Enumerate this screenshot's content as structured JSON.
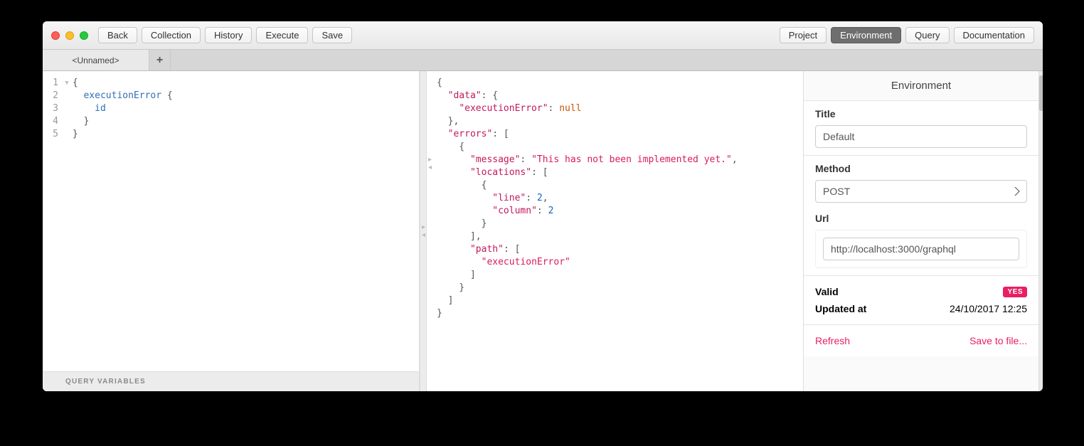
{
  "toolbar": {
    "left": [
      "Back",
      "Collection",
      "History",
      "Execute",
      "Save"
    ],
    "right": [
      "Project",
      "Environment",
      "Query",
      "Documentation"
    ],
    "active_right_index": 1
  },
  "tabs": {
    "items": [
      "<Unnamed>"
    ],
    "add_icon": "+"
  },
  "editor": {
    "lines": [
      {
        "n": "1",
        "fold": "▾",
        "tokens": [
          {
            "t": "{",
            "c": "punc"
          }
        ]
      },
      {
        "n": "2",
        "fold": "",
        "tokens": [
          {
            "t": "  ",
            "c": "punc"
          },
          {
            "t": "executionError",
            "c": "field dec"
          },
          {
            "t": " {",
            "c": "punc"
          }
        ]
      },
      {
        "n": "3",
        "fold": "",
        "tokens": [
          {
            "t": "    ",
            "c": "punc"
          },
          {
            "t": "id",
            "c": "field"
          }
        ]
      },
      {
        "n": "4",
        "fold": "",
        "tokens": [
          {
            "t": "  }",
            "c": "punc"
          }
        ]
      },
      {
        "n": "5",
        "fold": "",
        "tokens": [
          {
            "t": "}",
            "c": "punc"
          }
        ]
      }
    ],
    "query_variables_label": "QUERY VARIABLES"
  },
  "response": {
    "lines": [
      [
        {
          "t": "{",
          "c": "punc"
        }
      ],
      [
        {
          "t": "  ",
          "c": "punc"
        },
        {
          "t": "\"data\"",
          "c": "key"
        },
        {
          "t": ": {",
          "c": "punc"
        }
      ],
      [
        {
          "t": "    ",
          "c": "punc"
        },
        {
          "t": "\"executionError\"",
          "c": "key"
        },
        {
          "t": ": ",
          "c": "punc"
        },
        {
          "t": "null",
          "c": "null"
        }
      ],
      [
        {
          "t": "  },",
          "c": "punc"
        }
      ],
      [
        {
          "t": "  ",
          "c": "punc"
        },
        {
          "t": "\"errors\"",
          "c": "key"
        },
        {
          "t": ": [",
          "c": "punc"
        }
      ],
      [
        {
          "t": "    {",
          "c": "punc"
        }
      ],
      [
        {
          "t": "      ",
          "c": "punc"
        },
        {
          "t": "\"message\"",
          "c": "key"
        },
        {
          "t": ": ",
          "c": "punc"
        },
        {
          "t": "\"This has not been implemented yet.\"",
          "c": "msg"
        },
        {
          "t": ",",
          "c": "punc"
        }
      ],
      [
        {
          "t": "      ",
          "c": "punc"
        },
        {
          "t": "\"locations\"",
          "c": "key"
        },
        {
          "t": ": [",
          "c": "punc"
        }
      ],
      [
        {
          "t": "        {",
          "c": "punc"
        }
      ],
      [
        {
          "t": "          ",
          "c": "punc"
        },
        {
          "t": "\"line\"",
          "c": "key"
        },
        {
          "t": ": ",
          "c": "punc"
        },
        {
          "t": "2",
          "c": "num"
        },
        {
          "t": ",",
          "c": "punc"
        }
      ],
      [
        {
          "t": "          ",
          "c": "punc"
        },
        {
          "t": "\"column\"",
          "c": "key"
        },
        {
          "t": ": ",
          "c": "punc"
        },
        {
          "t": "2",
          "c": "num"
        }
      ],
      [
        {
          "t": "        }",
          "c": "punc"
        }
      ],
      [
        {
          "t": "      ],",
          "c": "punc"
        }
      ],
      [
        {
          "t": "      ",
          "c": "punc"
        },
        {
          "t": "\"path\"",
          "c": "key"
        },
        {
          "t": ": [",
          "c": "punc"
        }
      ],
      [
        {
          "t": "        ",
          "c": "punc"
        },
        {
          "t": "\"executionError\"",
          "c": "msg"
        }
      ],
      [
        {
          "t": "      ]",
          "c": "punc"
        }
      ],
      [
        {
          "t": "    }",
          "c": "punc"
        }
      ],
      [
        {
          "t": "  ]",
          "c": "punc"
        }
      ],
      [
        {
          "t": "}",
          "c": "punc"
        }
      ]
    ]
  },
  "environment": {
    "title": "Environment",
    "title_label": "Title",
    "title_value": "Default",
    "method_label": "Method",
    "method_value": "POST",
    "url_label": "Url",
    "url_value": "http://localhost:3000/graphql",
    "valid_label": "Valid",
    "valid_badge": "YES",
    "updated_label": "Updated at",
    "updated_value": "24/10/2017 12:25",
    "refresh": "Refresh",
    "save_to_file": "Save to file..."
  }
}
